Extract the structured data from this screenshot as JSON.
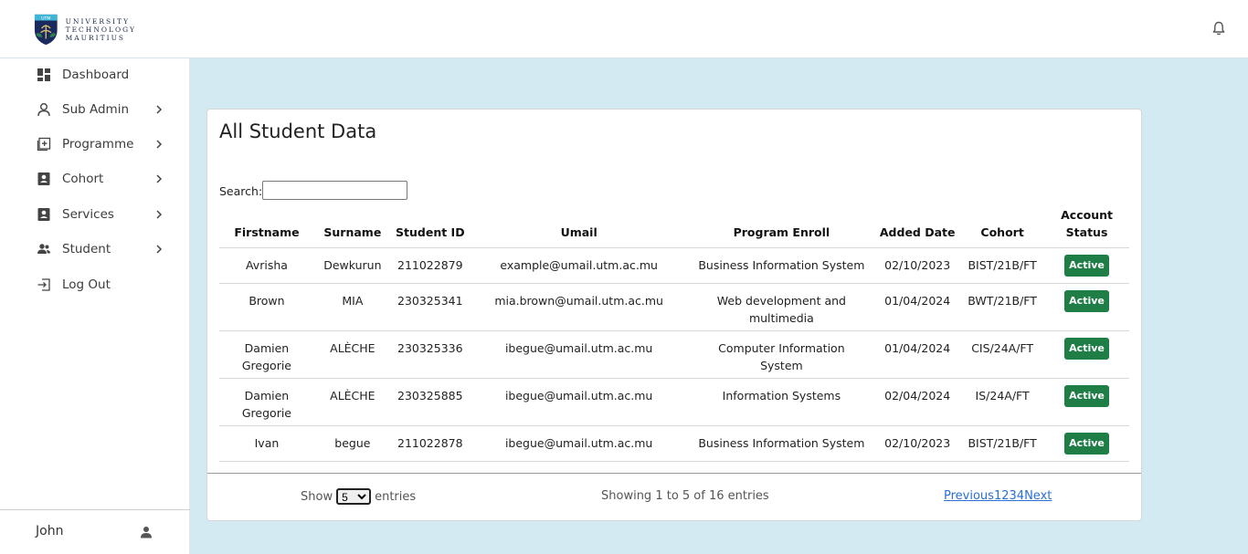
{
  "brand": {
    "logo_lines": [
      "UNIVERSITY",
      "TECHNOLOGY",
      "MAURITIUS"
    ],
    "shield_badge": "UTM"
  },
  "header": {
    "notification_icon": "bell-icon"
  },
  "sidebar": {
    "items": [
      {
        "label": "Dashboard",
        "icon": "dashboard-icon",
        "has_chevron": false
      },
      {
        "label": "Sub Admin",
        "icon": "user-icon",
        "has_chevron": true
      },
      {
        "label": "Programme",
        "icon": "plus-square-icon",
        "has_chevron": true
      },
      {
        "label": "Cohort",
        "icon": "id-badge-icon",
        "has_chevron": true
      },
      {
        "label": "Services",
        "icon": "id-badge-icon",
        "has_chevron": true
      },
      {
        "label": "Student",
        "icon": "users-icon",
        "has_chevron": true
      },
      {
        "label": "Log Out",
        "icon": "logout-icon",
        "has_chevron": false
      }
    ],
    "user_name": "John"
  },
  "main": {
    "title": "All Student Data",
    "search_label": "Search:",
    "search_value": "",
    "columns": [
      "Firstname",
      "Surname",
      "Student ID",
      "Umail",
      "Program Enroll",
      "Added Date",
      "Cohort",
      "Account Status"
    ],
    "rows": [
      {
        "firstname": "Avrisha",
        "surname": "Dewkurun",
        "student_id": "211022879",
        "umail": "example@umail.utm.ac.mu",
        "program": "Business Information System",
        "added": "02/10/2023",
        "cohort": "BIST/21B/FT",
        "status": "Active"
      },
      {
        "firstname": "Brown",
        "surname": "MIA",
        "student_id": "230325341",
        "umail": "mia.brown@umail.utm.ac.mu",
        "program": "Web development and multimedia",
        "added": "01/04/2024",
        "cohort": "BWT/21B/FT",
        "status": "Active"
      },
      {
        "firstname": "Damien Gregorie",
        "surname": "ALÈCHE",
        "student_id": "230325336",
        "umail": "ibegue@umail.utm.ac.mu",
        "program": "Computer Information System",
        "added": "01/04/2024",
        "cohort": "CIS/24A/FT",
        "status": "Active"
      },
      {
        "firstname": "Damien Gregorie",
        "surname": "ALÈCHE",
        "student_id": "230325885",
        "umail": "ibegue@umail.utm.ac.mu",
        "program": "Information Systems",
        "added": "02/04/2024",
        "cohort": "IS/24A/FT",
        "status": "Active"
      },
      {
        "firstname": "Ivan",
        "surname": "begue",
        "student_id": "211022878",
        "umail": "ibegue@umail.utm.ac.mu",
        "program": "Business Information System",
        "added": "02/10/2023",
        "cohort": "BIST/21B/FT",
        "status": "Active"
      }
    ],
    "footer": {
      "show_label": "Show",
      "entries_selected": "5",
      "entries_label": "entries",
      "info": "Showing 1 to 5 of 16 entries",
      "pager": [
        "Previous",
        "1",
        "2",
        "3",
        "4",
        "Next"
      ]
    }
  },
  "colors": {
    "main_bg": "#d3eaf2",
    "status_active": "#1e7e46",
    "link": "#2a6fd6"
  }
}
